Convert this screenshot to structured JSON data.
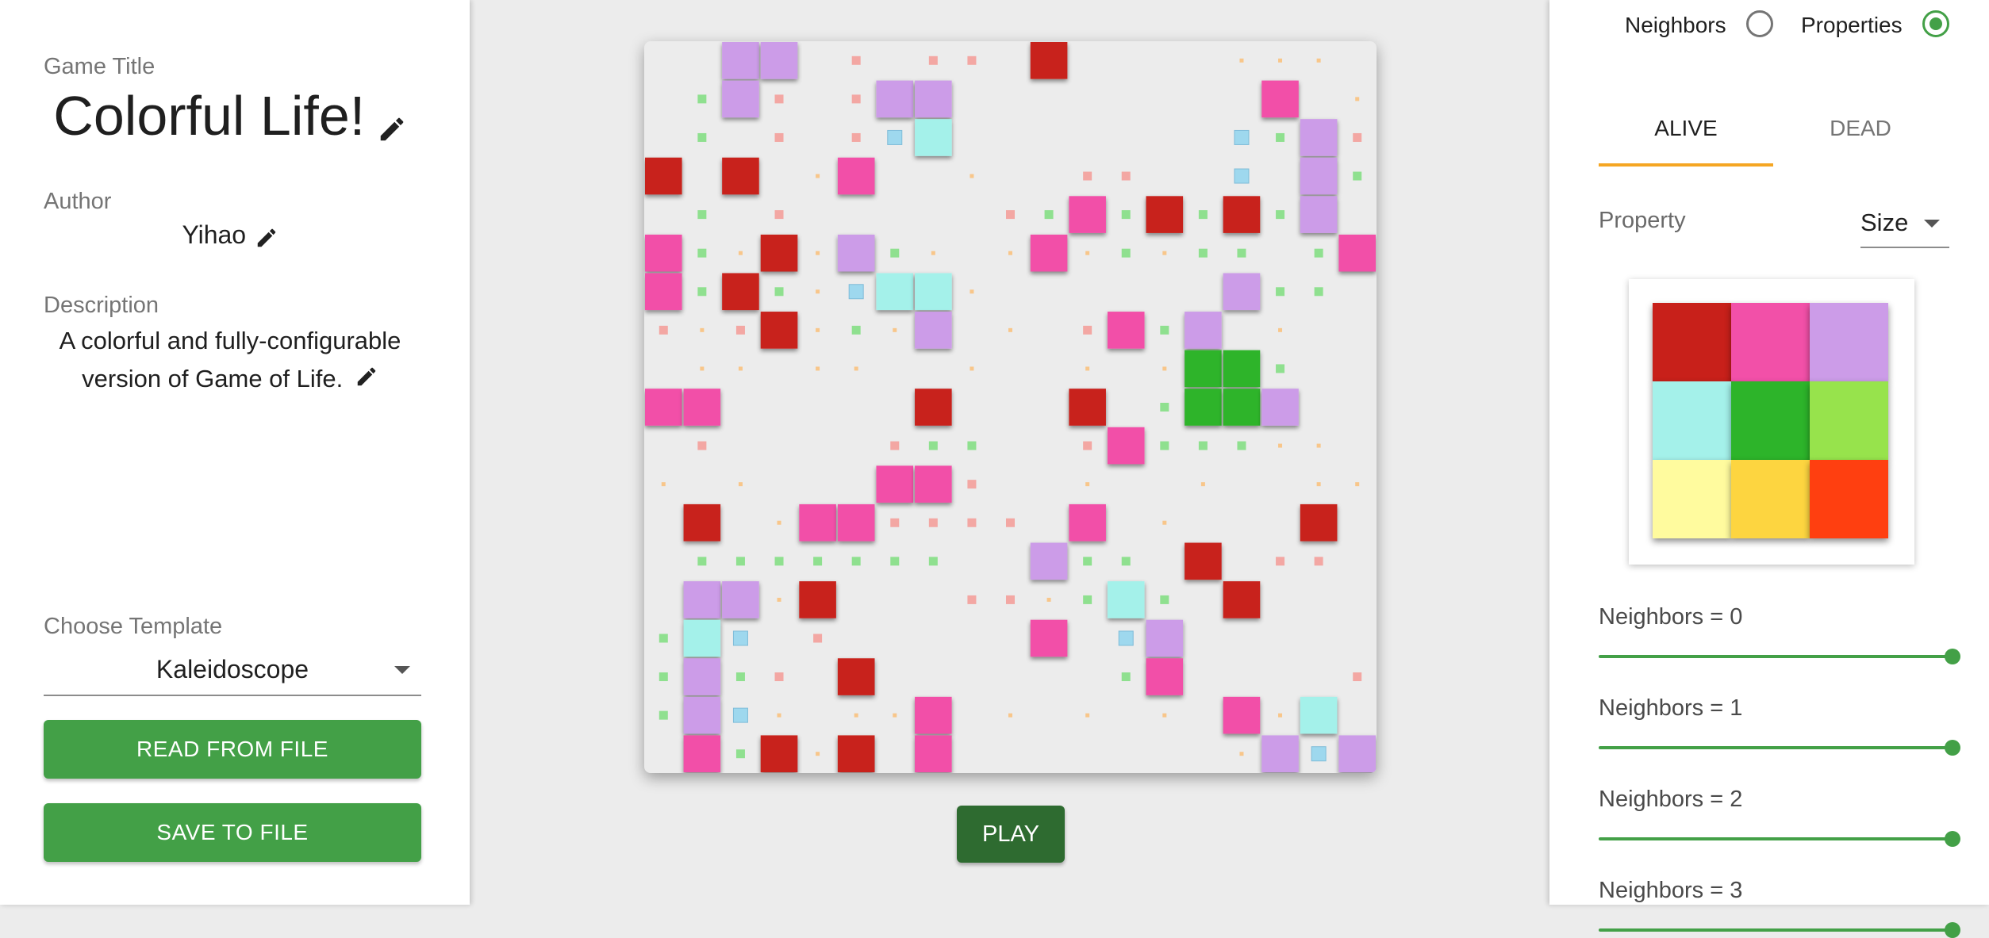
{
  "left": {
    "game_title_label": "Game Title",
    "game_title": "Colorful Life!",
    "author_label": "Author",
    "author": "Yihao",
    "description_label": "Description",
    "description_line1": "A colorful and fully-configurable",
    "description_line2": "version of Game of Life.",
    "template_label": "Choose Template",
    "template_value": "Kaleidoscope",
    "read_button": "READ FROM FILE",
    "save_button": "SAVE TO FILE"
  },
  "center": {
    "play_button": "PLAY",
    "board": {
      "rows": 19,
      "cols": 19,
      "cell_colors": {
        "R": "#c8201a",
        "P": "#f250a8",
        "L": "#cc9ce8",
        "C": "#a4f1ea",
        "G": "#2db42a"
      },
      "hint_colors": {
        "r": "#f3a7a3",
        "g": "#8fe08f",
        "o": "#f8c68a",
        "b": "#9ed8ee"
      },
      "grid": [
        "..LL.r.rr.R....ooo.",
        ".gLr.rLL........P.o",
        ".g.r.rbC.......bgLr",
        "R.R.oP..o..rr..b.Lg",
        ".g.r.....rgPgRgRgL.",
        "PgoRoLgo.oPogogg.gP",
        "PgRgobCCo......Lgg.",
        "rorRogoL.o.rPgL.o..",
        ".oo.oo..o..o.oGGg..",
        "PP.....R...R.gGGL..",
        ".r....rgg..rPgggoo.",
        "o.o...PPr..o..o..oo",
        ".R.oPPrrrr.P.o...R.",
        ".ggggggg..Lgg.R.rr.",
        ".LLoR...rrogCg.R...",
        "gCb.r.....P.bL.....",
        "gLgr.R......gP....r",
        "gLbo.ooP.o.o.o.PoC.",
        ".PgRoR.P.......oLbL"
      ]
    }
  },
  "right": {
    "radio_neighbors": "Neighbors",
    "radio_properties": "Properties",
    "tab_alive": "ALIVE",
    "tab_dead": "DEAD",
    "property_label": "Property",
    "property_value": "Size",
    "palette": [
      "#c8201a",
      "#f250a8",
      "#cc9ce8",
      "#a4f1ea",
      "#2db42a",
      "#97e34c",
      "#fffb9e",
      "#fdd540",
      "#ff3f10"
    ],
    "sliders": [
      {
        "label": "Neighbors = 0",
        "value": 1.0
      },
      {
        "label": "Neighbors = 1",
        "value": 1.0
      },
      {
        "label": "Neighbors = 2",
        "value": 1.0
      },
      {
        "label": "Neighbors = 3",
        "value": 1.0
      }
    ]
  }
}
